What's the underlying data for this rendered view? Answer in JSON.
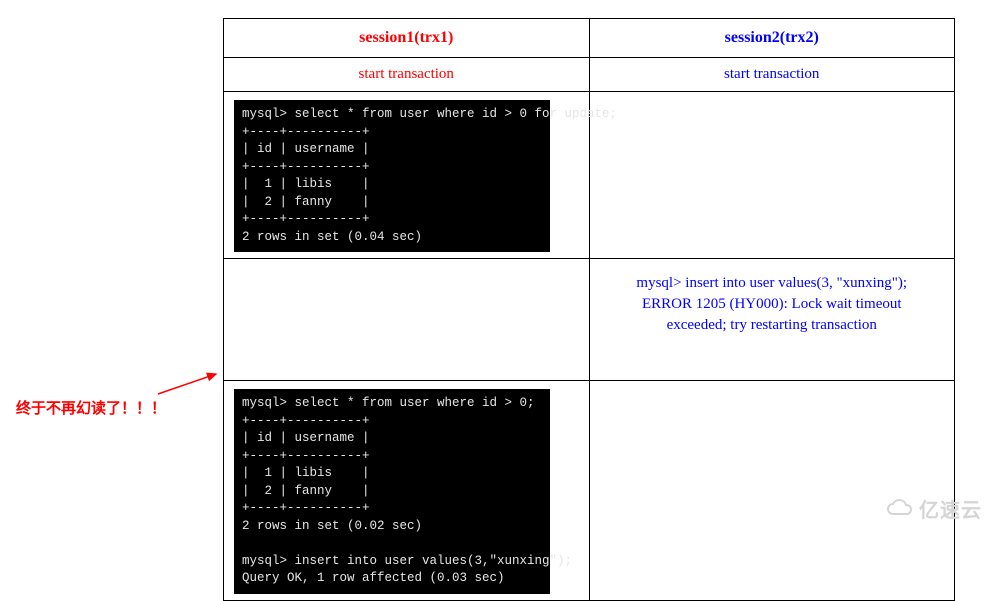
{
  "headers": {
    "s1": "session1(trx1)",
    "s2": "session2(trx2)"
  },
  "row_start": {
    "s1": "start transaction",
    "s2": "start transaction"
  },
  "terminal1": "mysql> select * from user where id > 0 for update;\n+----+----------+\n| id | username |\n+----+----------+\n|  1 | libis    |\n|  2 | fanny    |\n+----+----------+\n2 rows in set (0.04 sec)",
  "error_s2": {
    "l1": "mysql> insert into user values(3, \"xunxing\");",
    "l2": "ERROR 1205 (HY000): Lock wait timeout",
    "l3": "exceeded; try restarting transaction"
  },
  "terminal2": "mysql> select * from user where id > 0;\n+----+----------+\n| id | username |\n+----+----------+\n|  1 | libis    |\n|  2 | fanny    |\n+----+----------+\n2 rows in set (0.02 sec)\n\nmysql> insert into user values(3,\"xunxing\");\nQuery OK, 1 row affected (0.03 sec)",
  "annotation": "终于不再幻读了！！！",
  "watermark": "亿速云"
}
